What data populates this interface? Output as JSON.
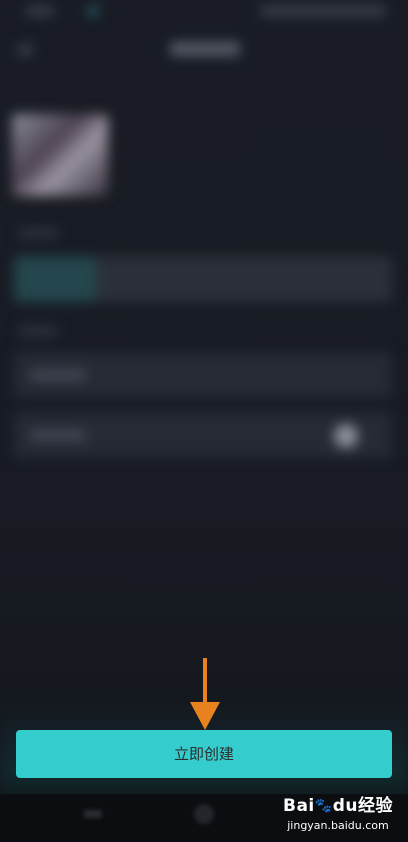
{
  "footer": {
    "create_button_label": "立即创建"
  },
  "watermark": {
    "brand_left": "Bai",
    "brand_mid": "du",
    "brand_right": "经验",
    "site": "jingyan.baidu.com"
  },
  "annotation": {
    "arrow_color": "#e8821e"
  },
  "colors": {
    "accent": "#35cccd",
    "background": "#191c24"
  },
  "icons": {
    "annotation": "arrow-down-icon",
    "watermark_mark": "baidu-paw-icon"
  }
}
